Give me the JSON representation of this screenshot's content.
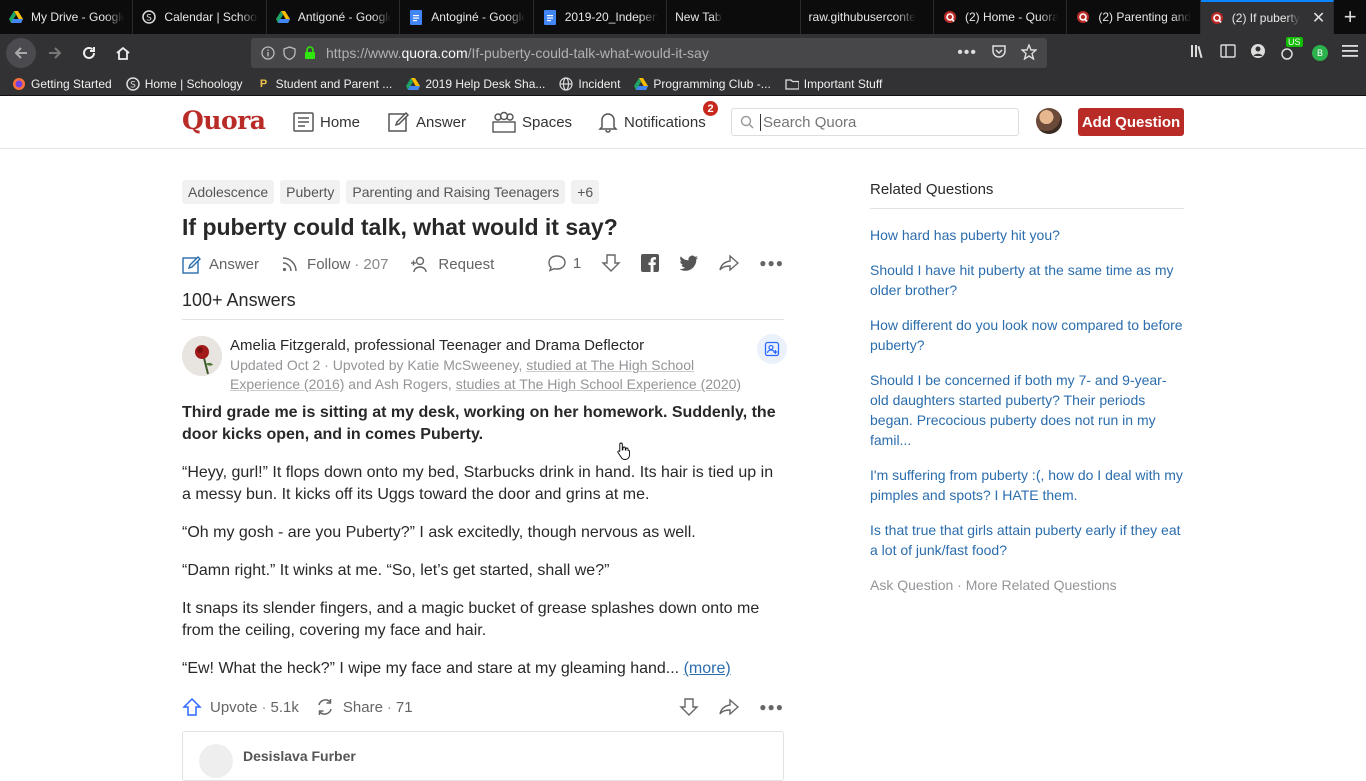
{
  "browser": {
    "tabs": [
      {
        "label": "My Drive - Google",
        "icon": "drive-icon"
      },
      {
        "label": "Calendar | Schoology",
        "icon": "schoology-icon"
      },
      {
        "label": "Antigoné - Google",
        "icon": "drive-icon"
      },
      {
        "label": "Antoginé - Google",
        "icon": "docs-icon"
      },
      {
        "label": "2019-20_Indepen",
        "icon": "docs-icon"
      },
      {
        "label": "New Tab",
        "icon": ""
      },
      {
        "label": "raw.githubuserconte",
        "icon": ""
      },
      {
        "label": "(2) Home - Quora",
        "icon": "quora-icon"
      },
      {
        "label": "(2) Parenting and",
        "icon": "quora-icon"
      },
      {
        "label": "(2) If puberty",
        "icon": "quora-icon",
        "active": true
      }
    ],
    "url_prefix": "https://www.",
    "url_domain": "quora.com",
    "url_path": "/If-puberty-could-talk-what-would-it-say",
    "bookmarks": [
      {
        "label": "Getting Started",
        "icon": "firefox-icon"
      },
      {
        "label": "Home | Schoology",
        "icon": "schoology-icon"
      },
      {
        "label": "Student and Parent ...",
        "icon": "p-icon"
      },
      {
        "label": "2019 Help Desk Sha...",
        "icon": "drive-icon"
      },
      {
        "label": "Incident",
        "icon": "globe-icon"
      },
      {
        "label": "Programming Club -...",
        "icon": "drive-icon"
      },
      {
        "label": "Important Stuff",
        "icon": "folder-icon"
      }
    ],
    "ext_badge": "US",
    "profile_letter": "B"
  },
  "header": {
    "logo": "Quora",
    "nav": {
      "home": "Home",
      "answer": "Answer",
      "spaces": "Spaces",
      "notifications": "Notifications",
      "notif_count": "2"
    },
    "search_placeholder": "Search Quora",
    "add_question": "Add Question"
  },
  "question": {
    "topics": [
      "Adolescence",
      "Puberty",
      "Parenting and Raising Teenagers",
      "+6"
    ],
    "title": "If puberty could talk, what would it say?",
    "actions": {
      "answer": "Answer",
      "follow": "Follow",
      "follow_count": "207",
      "request": "Request",
      "comment_count": "1"
    },
    "answers_count": "100+ Answers"
  },
  "answer": {
    "author": "Amelia Fitzgerald, professional Teenager and Drama Deflector",
    "meta_prefix": "Updated Oct 2 · Upvoted by Katie McSweeney, ",
    "meta_link1": "studied at The High School Experience (2016)",
    "meta_mid": " and Ash Rogers, ",
    "meta_link2": "studies at The High School Experience (2020)",
    "paragraphs": [
      "Third grade me is sitting at my desk, working on her homework. Suddenly, the door kicks open, and in comes Puberty.",
      "“Heyy, gurl!” It flops down onto my bed, Starbucks drink in hand. Its hair is tied up in a messy bun. It kicks off its Uggs toward the door and grins at me.",
      "“Oh my gosh - are you Puberty?” I ask excitedly, though nervous as well.",
      "“Damn right.” It winks at me. “So, let’s get started, shall we?”",
      "It snaps its slender fingers, and a magic bucket of grease splashes down onto me from the ceiling, covering my face and hair.",
      "“Ew! What the heck?” I wipe my face and stare at my gleaming hand..."
    ],
    "more": "(more)",
    "upvote": "Upvote",
    "upvote_count": "5.1k",
    "share": "Share",
    "share_count": "71"
  },
  "next_answer": {
    "author": "Desislava Furber"
  },
  "sidebar": {
    "title": "Related Questions",
    "items": [
      "How hard has puberty hit you?",
      "Should I have hit puberty at the same time as my older brother?",
      "How different do you look now compared to before puberty?",
      "Should I be concerned if both my 7- and 9-year-old daughters started puberty? Their periods began. Precocious puberty does not run in my famil...",
      "I'm suffering from puberty :(, how do I deal with my pimples and spots? I HATE them.",
      "Is that true that girls attain puberty early if they eat a lot of junk/fast food?"
    ],
    "footer": "Ask Question · More Related Questions"
  },
  "colors": {
    "quora_red": "#b92b27",
    "link_blue": "#2b6dad",
    "browser_dark": "#0c0c0d"
  }
}
